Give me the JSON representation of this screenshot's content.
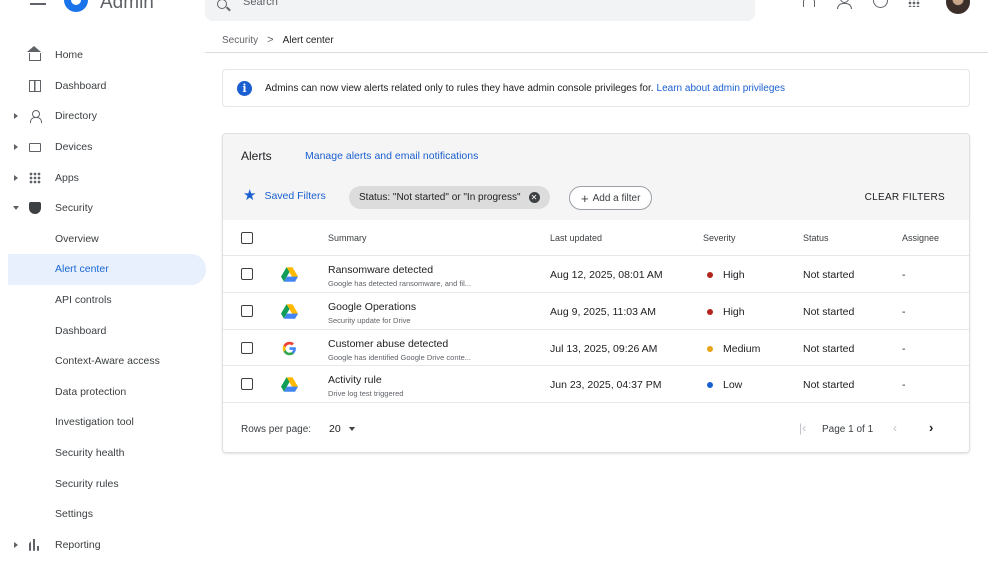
{
  "app": {
    "title": "Admin"
  },
  "search": {
    "placeholder": "Search"
  },
  "topbar_icons": [
    "menu-icon",
    "bell-icon",
    "person-icon",
    "help-icon",
    "apps-grid-icon",
    "avatar"
  ],
  "sidebar": {
    "items": [
      {
        "label": "Home",
        "icon": "home-icon",
        "caret": "none"
      },
      {
        "label": "Dashboard",
        "icon": "dashboard-icon",
        "caret": "none"
      },
      {
        "label": "Directory",
        "icon": "person-icon",
        "caret": "right"
      },
      {
        "label": "Devices",
        "icon": "devices-icon",
        "caret": "right"
      },
      {
        "label": "Apps",
        "icon": "apps-icon",
        "caret": "right"
      },
      {
        "label": "Security",
        "icon": "shield-icon",
        "caret": "down"
      },
      {
        "label": "Overview",
        "sub": true
      },
      {
        "label": "Alert center",
        "sub": true,
        "active": true
      },
      {
        "label": "API controls",
        "sub": true
      },
      {
        "label": "Dashboard",
        "sub": true
      },
      {
        "label": "Context-Aware access",
        "sub": true
      },
      {
        "label": "Data protection",
        "sub": true
      },
      {
        "label": "Investigation tool",
        "sub": true
      },
      {
        "label": "Security health",
        "sub": true
      },
      {
        "label": "Security rules",
        "sub": true
      },
      {
        "label": "Settings",
        "sub": true
      },
      {
        "label": "Reporting",
        "icon": "bar-chart-icon",
        "caret": "right"
      }
    ]
  },
  "breadcrumb": {
    "parent": "Security",
    "separator": ">",
    "current": "Alert center"
  },
  "banner": {
    "text": "Admins can now view alerts related only to rules they have admin console privileges for.",
    "link": "Learn about admin privileges"
  },
  "alerts_card": {
    "title": "Alerts",
    "manage_link": "Manage alerts and email notifications",
    "saved_filters": "Saved Filters",
    "filter_chip": "Status: \"Not started\" or \"In progress\"",
    "add_filter": "Add a filter",
    "clear_filters": "CLEAR FILTERS",
    "columns": {
      "summary": "Summary",
      "last_updated": "Last updated",
      "severity": "Severity",
      "status": "Status",
      "assignee": "Assignee"
    },
    "rows": [
      {
        "icon": "google-drive-icon",
        "title": "Ransomware detected",
        "desc": "Google has detected ransomware, and fil...",
        "date": "Aug 12, 2025, 08:01 AM",
        "severity": "High",
        "severity_color": "#b3261e",
        "status": "Not started",
        "assignee": "-"
      },
      {
        "icon": "google-drive-icon",
        "title": "Google Operations",
        "desc": "Security update for Drive",
        "date": "Aug 9, 2025, 11:03 AM",
        "severity": "High",
        "severity_color": "#b3261e",
        "status": "Not started",
        "assignee": "-"
      },
      {
        "icon": "google-g-icon",
        "title": "Customer abuse detected",
        "desc": "Google has identified Google Drive conte...",
        "date": "Jul 13, 2025, 09:26 AM",
        "severity": "Medium",
        "severity_color": "#e8a317",
        "status": "Not started",
        "assignee": "-"
      },
      {
        "icon": "google-drive-icon",
        "title": "Activity rule",
        "desc": "Drive log test triggered",
        "date": "Jun 23, 2025, 04:37 PM",
        "severity": "Low",
        "severity_color": "#1a5fd0",
        "status": "Not started",
        "assignee": "-"
      }
    ],
    "footer": {
      "rows_per_page_label": "Rows per page:",
      "rows_per_page_value": "20",
      "page_label": "Page 1 of 1"
    }
  },
  "colors": {
    "accent": "#1a5fd0",
    "active_bg": "#e8f0fe",
    "header_bg": "#f5f5f5"
  }
}
